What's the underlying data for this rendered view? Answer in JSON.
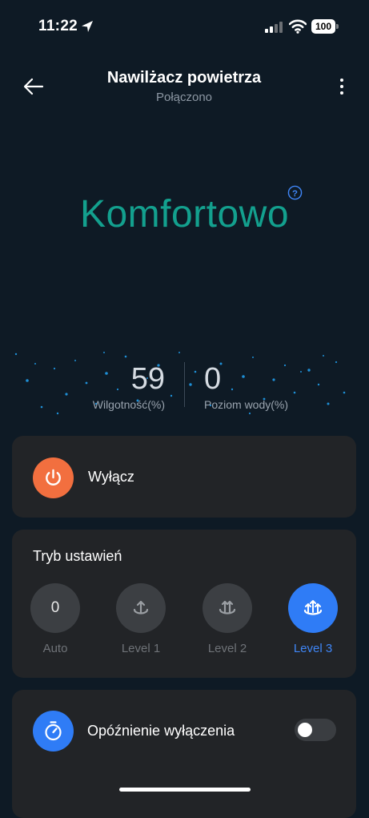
{
  "status_bar": {
    "time": "11:22",
    "battery": "100"
  },
  "header": {
    "title": "Nawilżacz powietrza",
    "subtitle": "Połączono"
  },
  "hero": {
    "status": "Komfortowo",
    "status_color": "#13a08e"
  },
  "stats": {
    "humidity_value": "59",
    "humidity_label": "Wilgotność(%)",
    "water_value": "0",
    "water_label": "Poziom wody(%)"
  },
  "power": {
    "label": "Wyłącz",
    "color": "#f26f3f"
  },
  "mode": {
    "title": "Tryb ustawień",
    "options": [
      {
        "label": "Auto",
        "icon_text": "0",
        "active": false
      },
      {
        "label": "Level 1",
        "icon": "mist-level-1-icon",
        "active": false
      },
      {
        "label": "Level 2",
        "icon": "mist-level-2-icon",
        "active": false
      },
      {
        "label": "Level 3",
        "icon": "mist-level-3-icon",
        "active": true
      }
    ],
    "active_color": "#2f7cf6"
  },
  "delay": {
    "label": "Opóźnienie wyłączenia",
    "enabled": false
  }
}
